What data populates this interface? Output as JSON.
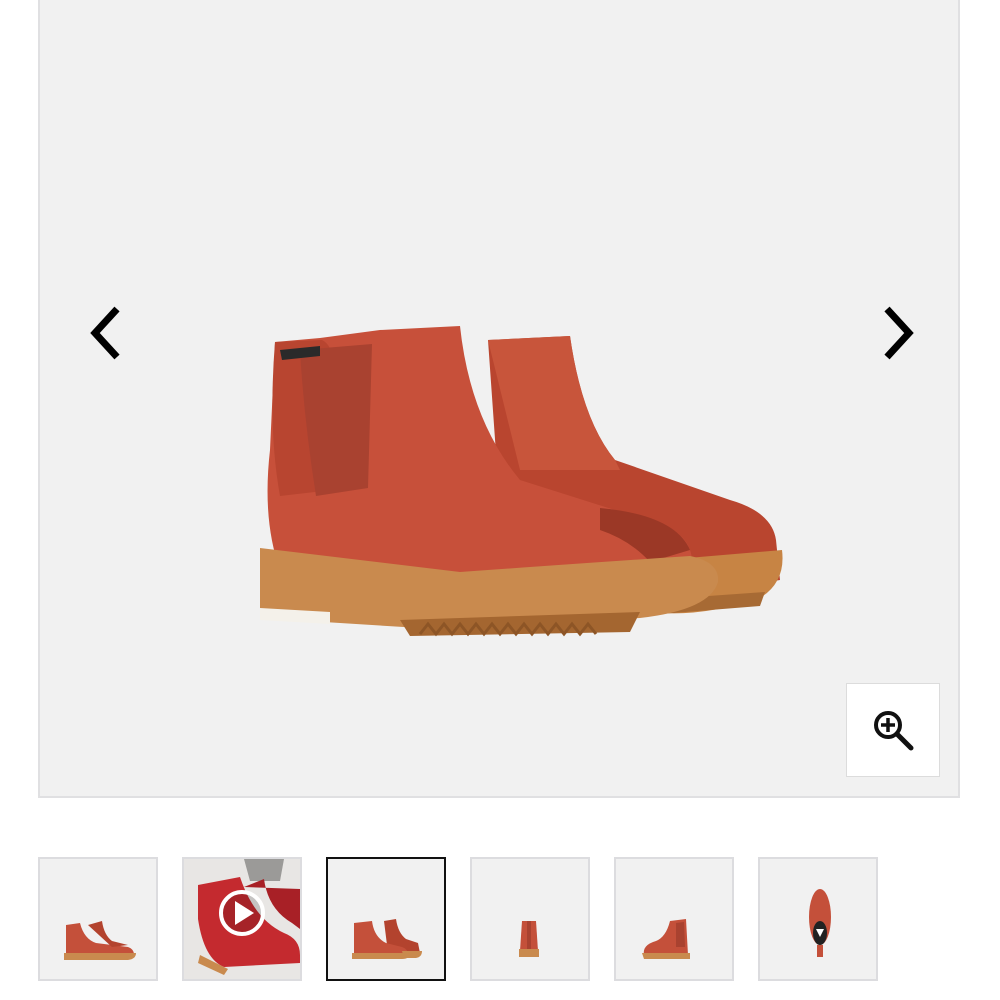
{
  "gallery": {
    "main_image_alt": "",
    "prev_label": "",
    "next_label": "",
    "zoom_label": "",
    "thumbnails": [
      {
        "kind": "pair-side-view",
        "selected": false,
        "is_video": false
      },
      {
        "kind": "on-foot-video",
        "selected": false,
        "is_video": true
      },
      {
        "kind": "pair-three-quarter",
        "selected": true,
        "is_video": false
      },
      {
        "kind": "heel-view",
        "selected": false,
        "is_video": false
      },
      {
        "kind": "single-side-view",
        "selected": false,
        "is_video": false
      },
      {
        "kind": "sole-top-view",
        "selected": false,
        "is_video": false
      }
    ]
  },
  "icons": {
    "prev": "chevron-left-icon",
    "next": "chevron-right-icon",
    "zoom": "zoom-in-icon",
    "play": "play-icon"
  },
  "colors": {
    "background": "#f1f1f1",
    "suede": "#c4503a",
    "sole": "#c98a4e",
    "selected_border": "#111111"
  }
}
